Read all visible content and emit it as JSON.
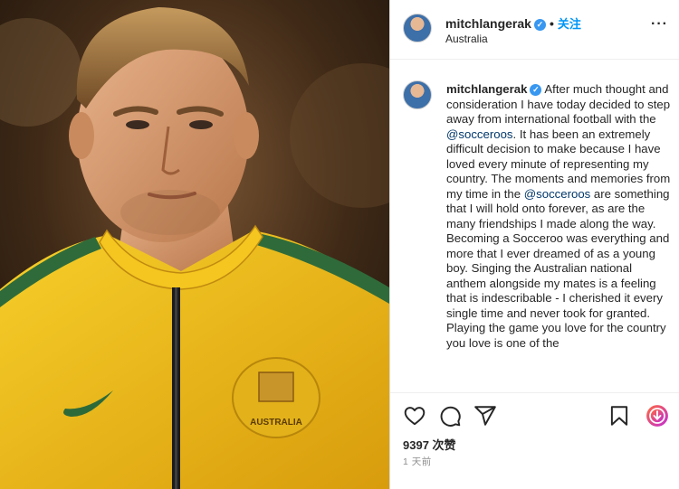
{
  "post": {
    "username": "mitchlangerak",
    "location": "Australia",
    "follow_label": "关注",
    "separator": "•",
    "more_label": "···",
    "verified_mark": "✓"
  },
  "caption": {
    "username": "mitchlangerak",
    "text_part1": " After much thought and consideration I have today decided to step away from international football with the ",
    "mention1": "@socceroos",
    "text_part2": ". It has been an extremely difficult decision to make because I have loved every minute of representing my country. The moments and memories from my time in the ",
    "mention2": "@socceroos",
    "text_part3": " are something that I will hold onto forever, as are the many friendships I made along the way. Becoming a Socceroo was everything and more that I ever dreamed of as a young boy. Singing the Australian national anthem alongside my mates is a feeling that is indescribable - I cherished it every single time and never took for granted. Playing the game you love for the country you love is one of the"
  },
  "actions": {
    "like_icon": "heart-icon",
    "comment_icon": "comment-icon",
    "share_icon": "send-icon",
    "save_icon": "bookmark-icon",
    "extra_icon": "download-icon",
    "likes_count": "9397",
    "likes_label": "次赞",
    "time": "1 天前"
  },
  "photo": {
    "badge_text": "AUSTRALIA"
  },
  "colors": {
    "accent": "#0095f6",
    "verified": "#3897f0",
    "mention": "#00376b",
    "jersey": "#f2c21a",
    "jersey_stripe": "#2f6b3a"
  }
}
